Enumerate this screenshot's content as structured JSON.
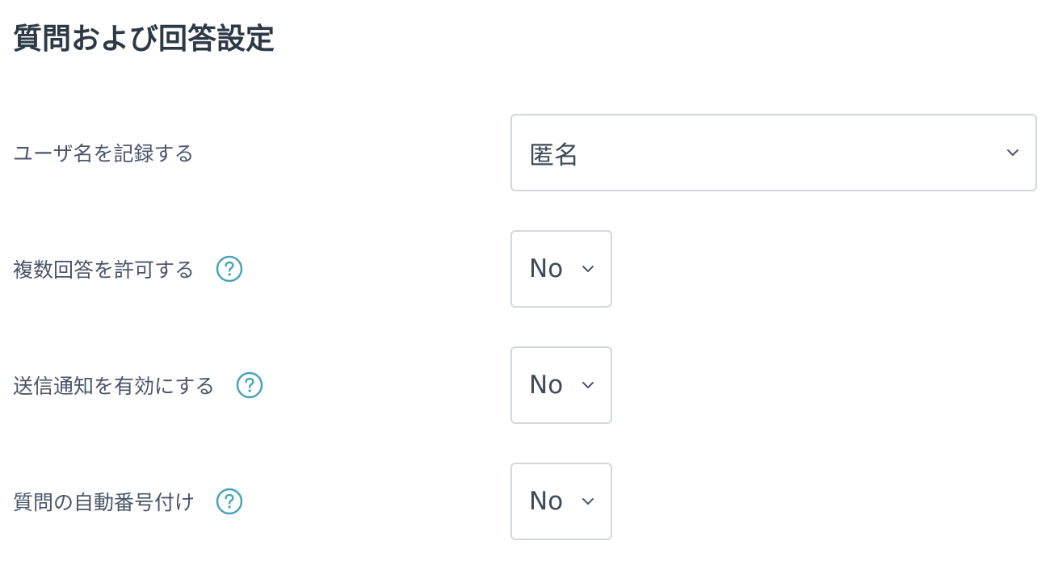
{
  "page": {
    "title": "質問および回答設定"
  },
  "settings": [
    {
      "label": "ユーザ名を記録する",
      "value": "匿名",
      "help_icon": false
    },
    {
      "label": "複数回答を許可する",
      "value": "No",
      "help_icon": true
    },
    {
      "label": "送信通知を有効にする",
      "value": "No",
      "help_icon": true
    },
    {
      "label": "質問の自動番号付け",
      "value": "No",
      "help_icon": true
    }
  ],
  "icons": {
    "help": "question-circle-icon",
    "dropdown": "chevron-down-icon"
  },
  "colors": {
    "heading": "#2d3a45",
    "label": "#4a5568",
    "help_icon": "#4aa3b5",
    "select_border": "#d4d7dc"
  }
}
